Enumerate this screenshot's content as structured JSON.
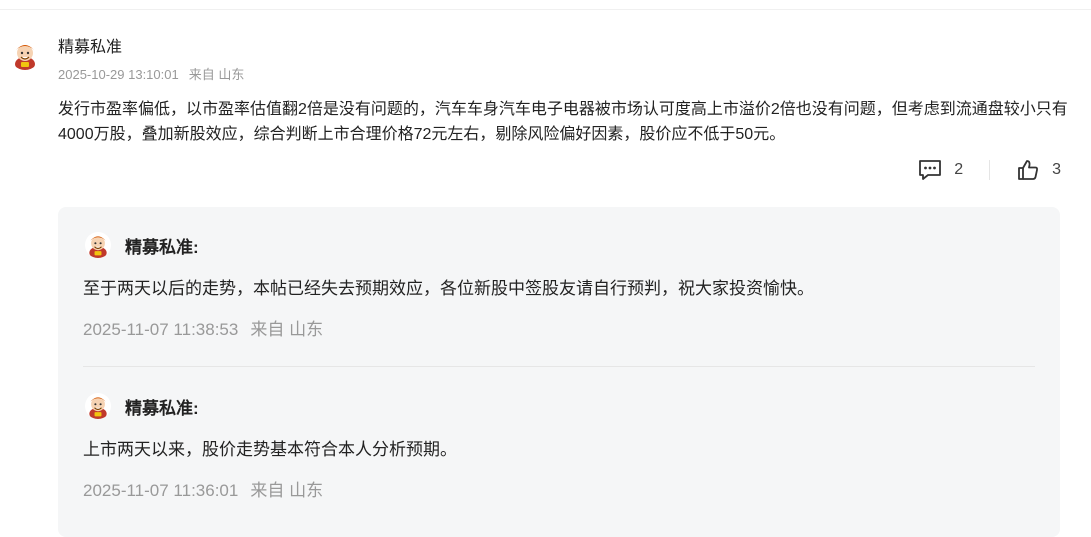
{
  "comment": {
    "username": "精募私准",
    "timestamp": "2025-10-29 13:10:01",
    "location": "来自 山东",
    "content": "发行市盈率偏低，以市盈率估值翻2倍是没有问题的，汽车车身汽车电子电器被市场认可度高上市溢价2倍也没有问题，但考虑到流通盘较小只有4000万股，叠加新股效应，综合判断上市合理价格72元左右，剔除风险偏好因素，股价应不低于50元。",
    "reply_count": "2",
    "like_count": "3",
    "avatar_icon": "cartoon-avatar-icon",
    "reply_icon": "comment-bubble-icon",
    "like_icon": "thumbs-up-icon"
  },
  "replies": [
    {
      "username": "精募私准:",
      "text": "至于两天以后的走势，本帖已经失去预期效应，各位新股中签股友请自行预判，祝大家投资愉快。",
      "timestamp": "2025-11-07 11:38:53",
      "location": "来自 山东"
    },
    {
      "username": "精募私准:",
      "text": "上市两天以来，股价走势基本符合本人分析预期。",
      "timestamp": "2025-11-07 11:36:01",
      "location": "来自 山东"
    }
  ],
  "colors": {
    "text": "#222222",
    "muted": "#999999",
    "reply_bg": "#f5f6f7"
  }
}
